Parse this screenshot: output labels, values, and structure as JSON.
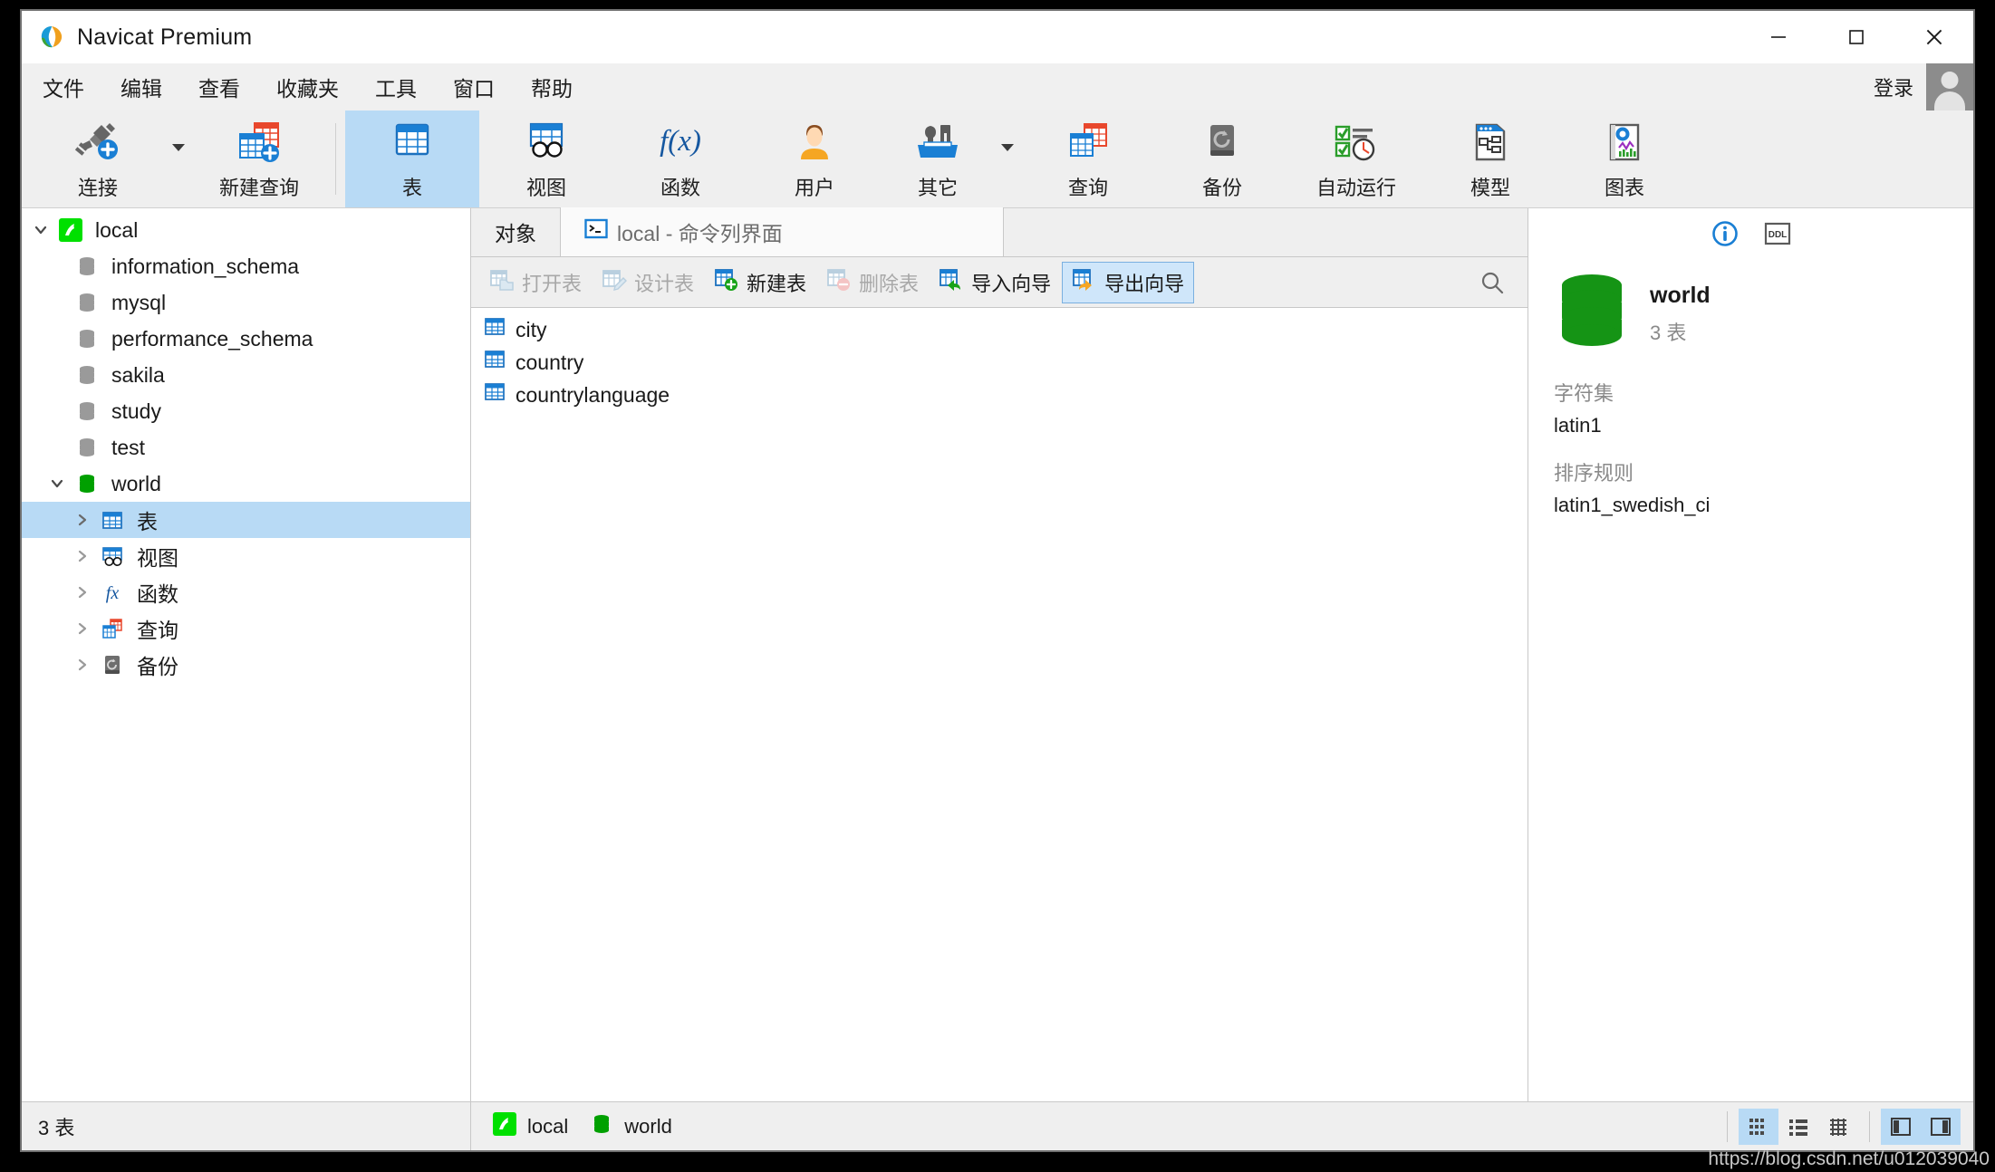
{
  "window": {
    "title": "Navicat Premium",
    "minimize": "—",
    "maximize": "☐",
    "close": "✕"
  },
  "menubar": {
    "items": [
      {
        "label": "文件"
      },
      {
        "label": "编辑"
      },
      {
        "label": "查看"
      },
      {
        "label": "收藏夹"
      },
      {
        "label": "工具"
      },
      {
        "label": "窗口"
      },
      {
        "label": "帮助"
      }
    ],
    "login_label": "登录"
  },
  "toolbar": {
    "items": [
      {
        "label": "连接",
        "icon": "connection-icon",
        "has_caret": true,
        "active": false
      },
      {
        "label": "新建查询",
        "icon": "new-query-icon",
        "has_caret": false,
        "active": false
      },
      {
        "label": "表",
        "icon": "table-icon",
        "has_caret": false,
        "active": true
      },
      {
        "label": "视图",
        "icon": "view-icon",
        "has_caret": false,
        "active": false
      },
      {
        "label": "函数",
        "icon": "function-icon",
        "has_caret": false,
        "active": false
      },
      {
        "label": "用户",
        "icon": "user-icon",
        "has_caret": false,
        "active": false
      },
      {
        "label": "其它",
        "icon": "other-tools-icon",
        "has_caret": true,
        "active": false
      },
      {
        "label": "查询",
        "icon": "query-icon",
        "has_caret": false,
        "active": false
      },
      {
        "label": "备份",
        "icon": "backup-icon",
        "has_caret": false,
        "active": false
      },
      {
        "label": "自动运行",
        "icon": "automation-icon",
        "has_caret": false,
        "active": false
      },
      {
        "label": "模型",
        "icon": "model-icon",
        "has_caret": false,
        "active": false
      },
      {
        "label": "图表",
        "icon": "chart-icon",
        "has_caret": false,
        "active": false
      }
    ]
  },
  "sidebar": {
    "nodes": [
      {
        "label": "local",
        "icon": "connection-node-icon",
        "level": 0,
        "twisty": "down",
        "selected": false
      },
      {
        "label": "information_schema",
        "icon": "database-gray-icon",
        "level": 1,
        "twisty": "none",
        "selected": false
      },
      {
        "label": "mysql",
        "icon": "database-gray-icon",
        "level": 1,
        "twisty": "none",
        "selected": false
      },
      {
        "label": "performance_schema",
        "icon": "database-gray-icon",
        "level": 1,
        "twisty": "none",
        "selected": false
      },
      {
        "label": "sakila",
        "icon": "database-gray-icon",
        "level": 1,
        "twisty": "none",
        "selected": false
      },
      {
        "label": "study",
        "icon": "database-gray-icon",
        "level": 1,
        "twisty": "none",
        "selected": false
      },
      {
        "label": "test",
        "icon": "database-gray-icon",
        "level": 1,
        "twisty": "none",
        "selected": false
      },
      {
        "label": "world",
        "icon": "database-green-icon",
        "level": 1,
        "twisty": "down",
        "selected": false
      },
      {
        "label": "表",
        "icon": "table-icon",
        "level": 2,
        "twisty": "right",
        "selected": true
      },
      {
        "label": "视图",
        "icon": "view-icon",
        "level": 2,
        "twisty": "right",
        "selected": false
      },
      {
        "label": "函数",
        "icon": "function-icon",
        "level": 2,
        "twisty": "right",
        "selected": false
      },
      {
        "label": "查询",
        "icon": "query-icon",
        "level": 2,
        "twisty": "right",
        "selected": false
      },
      {
        "label": "备份",
        "icon": "backup-icon",
        "level": 2,
        "twisty": "right",
        "selected": false
      }
    ]
  },
  "tabs": [
    {
      "label": "对象",
      "active": true,
      "icon": null
    },
    {
      "label": "local - 命令列界面",
      "active": false,
      "icon": "console-icon"
    }
  ],
  "objbar": {
    "buttons": [
      {
        "label": "打开表",
        "icon": "open-table-icon",
        "state": "disabled"
      },
      {
        "label": "设计表",
        "icon": "design-table-icon",
        "state": "disabled"
      },
      {
        "label": "新建表",
        "icon": "new-table-icon",
        "state": "enabled"
      },
      {
        "label": "删除表",
        "icon": "delete-table-icon",
        "state": "disabled"
      },
      {
        "label": "导入向导",
        "icon": "import-wizard-icon",
        "state": "enabled"
      },
      {
        "label": "导出向导",
        "icon": "export-wizard-icon",
        "state": "active"
      }
    ],
    "search_icon": "search-icon"
  },
  "objects": [
    {
      "name": "city",
      "icon": "table-icon"
    },
    {
      "name": "country",
      "icon": "table-icon"
    },
    {
      "name": "countrylanguage",
      "icon": "table-icon"
    }
  ],
  "info": {
    "tools": [
      {
        "icon": "info-circle-icon"
      },
      {
        "icon": "ddl-icon",
        "label": "DDL"
      }
    ],
    "db_icon": "database-green-icon",
    "db_name": "world",
    "db_sub": "3 表",
    "fields": [
      {
        "key": "字符集",
        "value": "latin1"
      },
      {
        "key": "排序规则",
        "value": "latin1_swedish_ci"
      }
    ]
  },
  "statusbar": {
    "count": "3 表",
    "connection": "local",
    "connection_icon": "connection-node-icon",
    "database": "world",
    "database_icon": "database-green-icon",
    "view_buttons": [
      {
        "icon": "grid-view-icon",
        "on": true
      },
      {
        "icon": "list-view-icon",
        "on": false
      },
      {
        "icon": "detail-view-icon",
        "on": false
      }
    ],
    "pane_buttons": [
      {
        "icon": "left-pane-toggle-icon",
        "on": true
      },
      {
        "icon": "right-pane-toggle-icon",
        "on": true
      }
    ]
  },
  "watermark": "https://blog.csdn.net/u012039040",
  "colors": {
    "accent": "#1a7fd4",
    "selection": "#b8daf5",
    "green": "#00a000",
    "toolbar_bg": "#efefef"
  }
}
